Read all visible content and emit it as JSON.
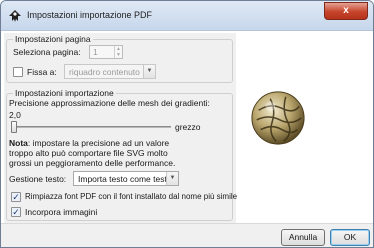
{
  "window": {
    "title": "Impostazioni importazione PDF",
    "close_label": "x"
  },
  "page_settings": {
    "legend": "Impostazioni pagina",
    "select_page_label": "Seleziona pagina:",
    "select_page_value": "1",
    "crop_label": "Fissa a:",
    "crop_checked": false,
    "crop_value": "riquadro contenuto"
  },
  "import_settings": {
    "legend": "Impostazioni importazione",
    "precision_label": "Precisione approssimazione delle mesh dei gradienti:",
    "precision_value": "2,0",
    "precision_fraction": 0.0,
    "precision_desc": "grezzo",
    "note_bold": "Nota",
    "note_line1": ": impostare la precisione ad un valore",
    "note_line2": "troppo alto può comportare file SVG molto",
    "note_line3": "grossi un peggioramento delle performance.",
    "text_handling_label": "Gestione testo:",
    "text_handling_value": "Importa testo come testo",
    "replace_fonts_label": "Rimpiazza font PDF con il font installato dal nome più simile",
    "replace_fonts_checked": true,
    "embed_images_label": "Incorpora immagini",
    "embed_images_checked": true
  },
  "buttons": {
    "cancel_label": "Annulla",
    "ok_label": "OK"
  },
  "icons": {
    "title": "inkscape-icon",
    "preview": "page-preview-thumbnail"
  }
}
